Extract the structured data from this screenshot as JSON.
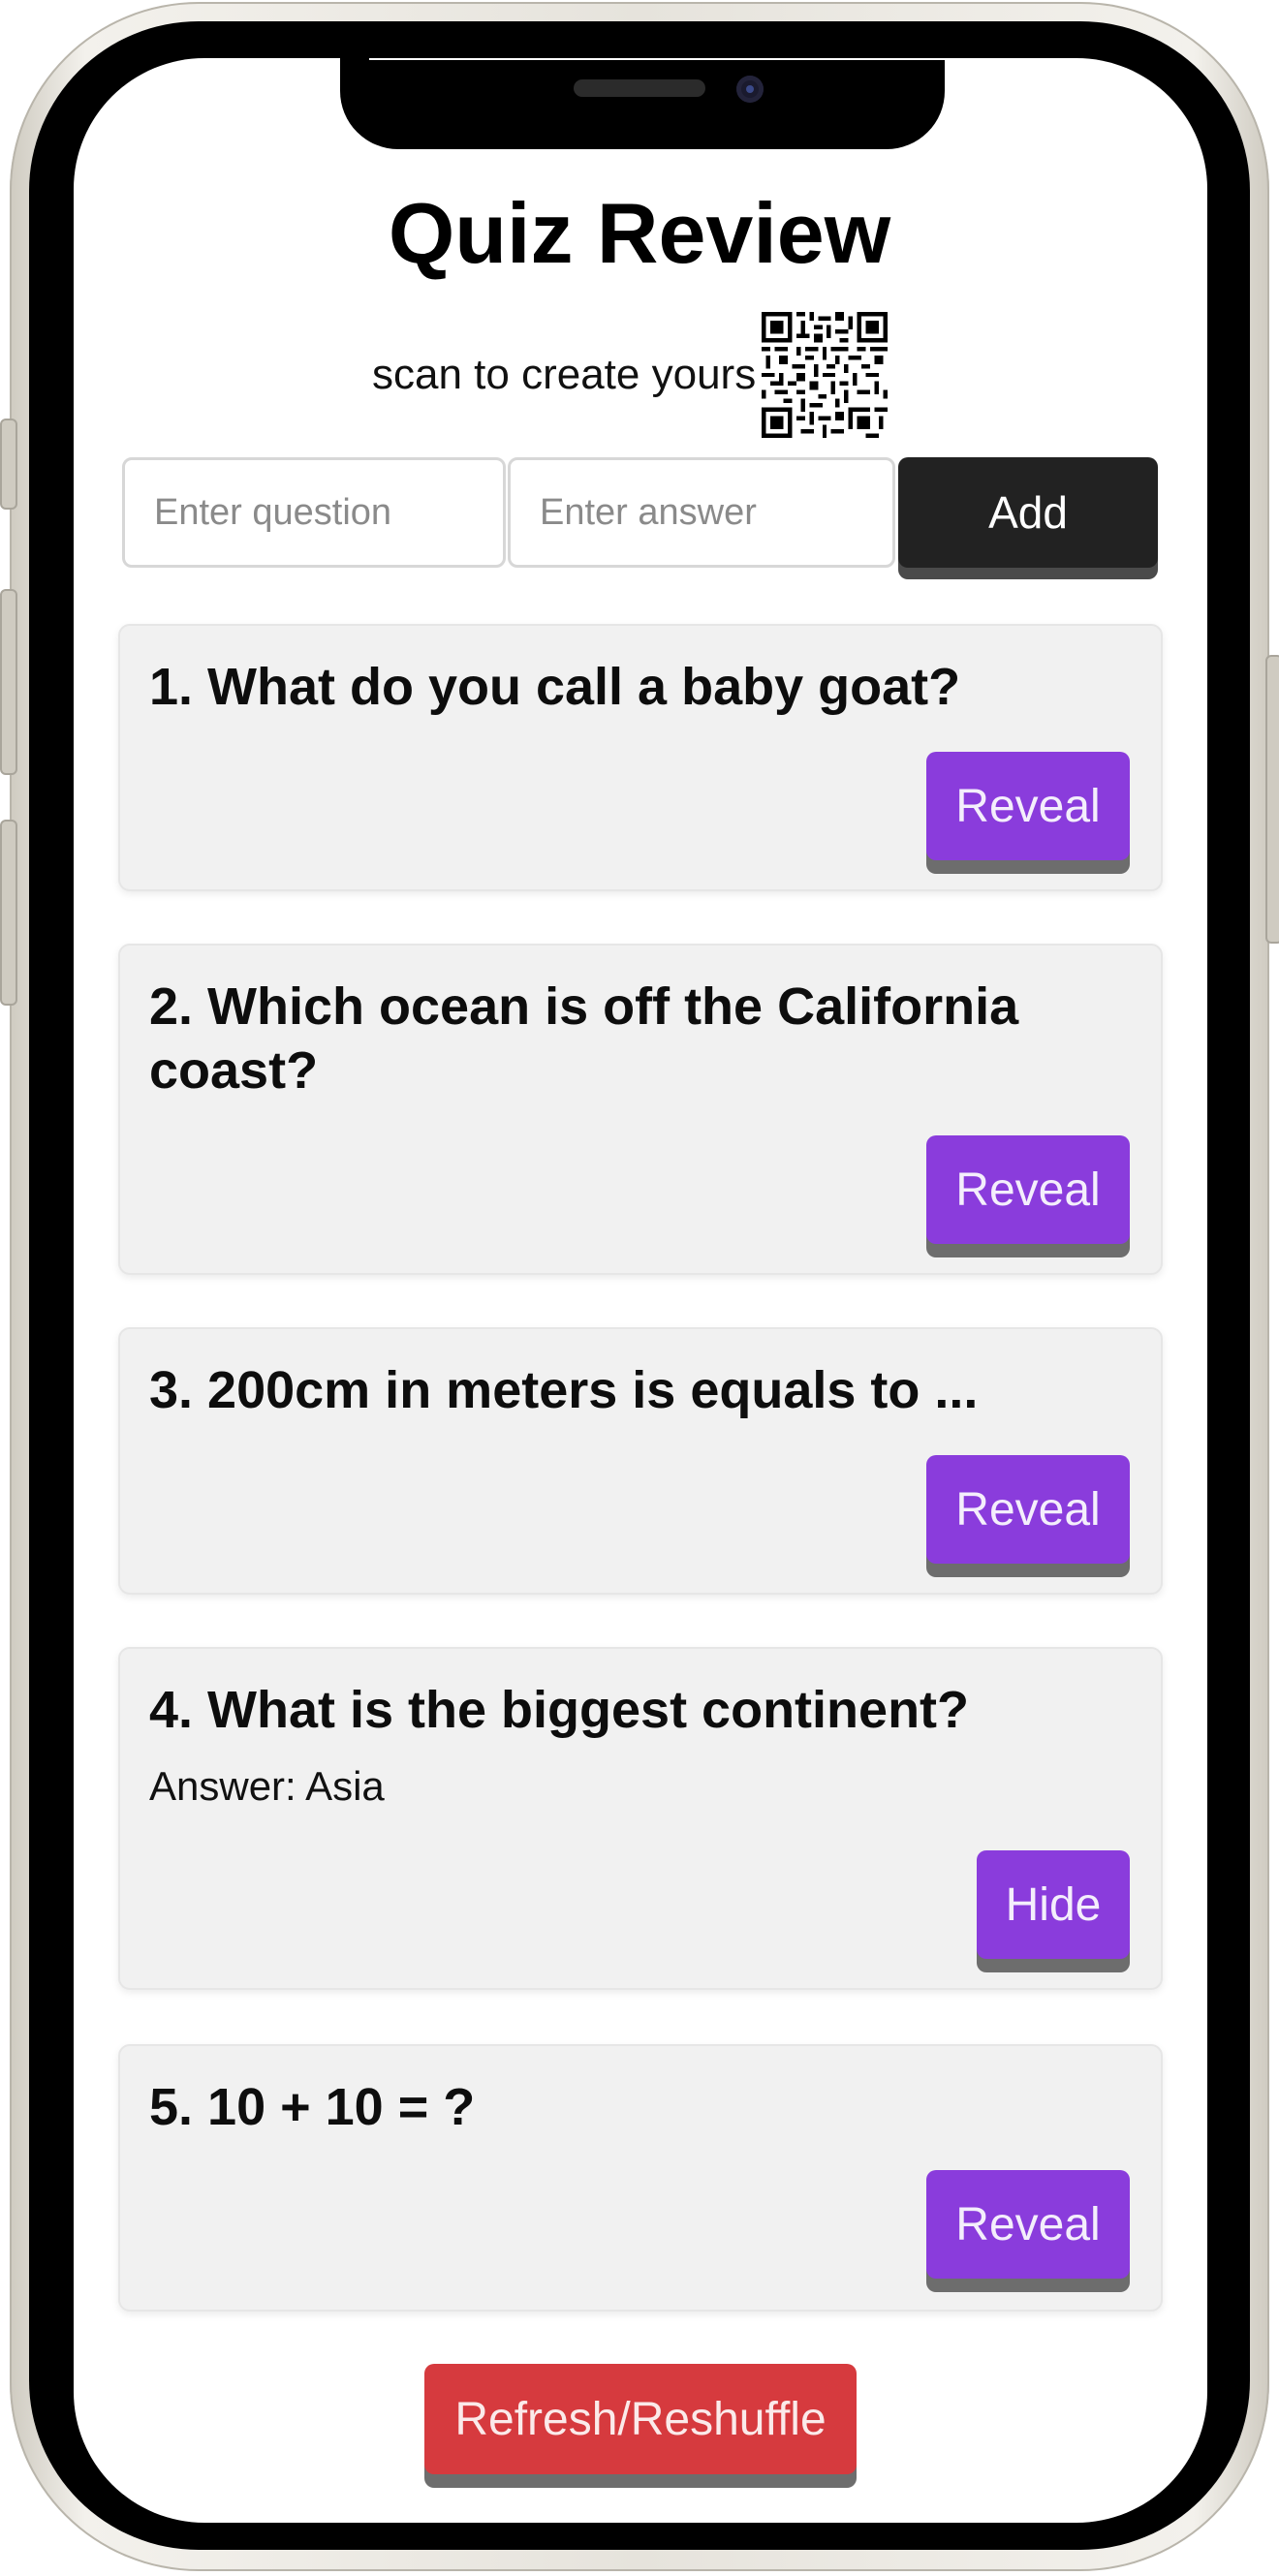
{
  "header": {
    "title": "Quiz Review",
    "scan_text": "scan to create yours"
  },
  "form": {
    "question_placeholder": "Enter question",
    "answer_placeholder": "Enter answer",
    "add_label": "Add"
  },
  "cards": [
    {
      "question": "1. What do you call a baby goat?",
      "button": "Reveal"
    },
    {
      "question": "2. Which ocean is off the California coast?",
      "button": "Reveal"
    },
    {
      "question": "3. 200cm in meters is equals to ...",
      "button": "Reveal"
    },
    {
      "question": "4. What is the biggest continent?",
      "answer": "Answer: Asia",
      "button": "Hide"
    },
    {
      "question": "5. 10 + 10 = ?",
      "button": "Reveal"
    }
  ],
  "footer": {
    "refresh_label": "Refresh/Reshuffle"
  },
  "colors": {
    "accent": "#8a3cdc",
    "danger": "#d63a3e",
    "dark_button": "#222222",
    "card_bg": "#f1f1f1"
  }
}
